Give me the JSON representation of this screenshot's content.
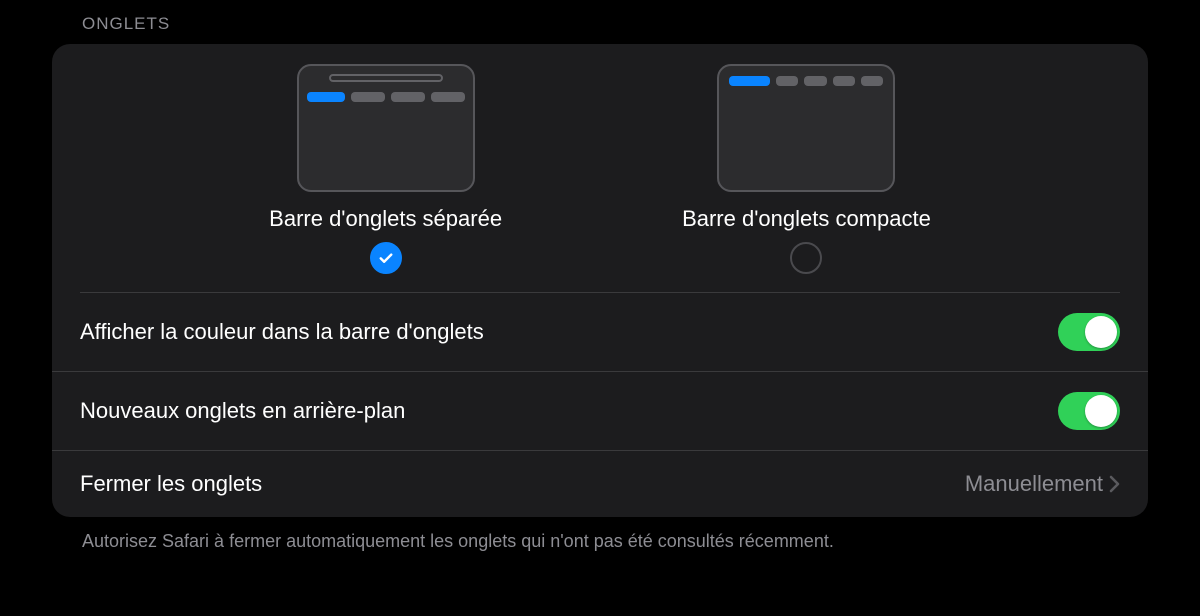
{
  "section_title": "Onglets",
  "layout": {
    "separate": {
      "label": "Barre d'onglets séparée",
      "selected": true
    },
    "compact": {
      "label": "Barre d'onglets compacte",
      "selected": false
    }
  },
  "rows": {
    "show_color": {
      "label": "Afficher la couleur dans la barre d'onglets",
      "on": true
    },
    "background_tabs": {
      "label": "Nouveaux onglets en arrière-plan",
      "on": true
    },
    "close_tabs": {
      "label": "Fermer les onglets",
      "value": "Manuellement"
    }
  },
  "footer": "Autorisez Safari à fermer automatiquement les onglets qui n'ont pas été consultés récemment."
}
